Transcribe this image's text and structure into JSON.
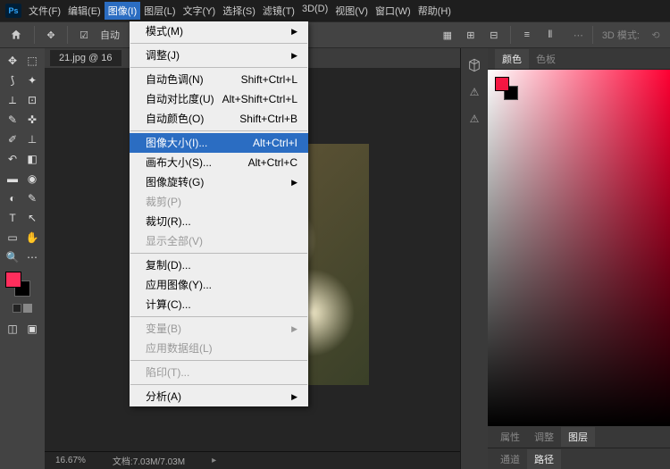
{
  "menubar": {
    "items": [
      "文件(F)",
      "编辑(E)",
      "图像(I)",
      "图层(L)",
      "文字(Y)",
      "选择(S)",
      "滤镜(T)",
      "3D(D)",
      "视图(V)",
      "窗口(W)",
      "帮助(H)"
    ],
    "active_index": 2
  },
  "toolbar": {
    "auto_label": "自动",
    "mode_label": "3D 模式:"
  },
  "document": {
    "tab": "21.jpg @ 16",
    "zoom": "16.67%",
    "docinfo": "文档:7.03M/7.03M"
  },
  "dropdown": {
    "groups": [
      [
        {
          "label": "模式(M)",
          "arrow": true
        }
      ],
      [
        {
          "label": "调整(J)",
          "arrow": true
        }
      ],
      [
        {
          "label": "自动色调(N)",
          "shortcut": "Shift+Ctrl+L"
        },
        {
          "label": "自动对比度(U)",
          "shortcut": "Alt+Shift+Ctrl+L"
        },
        {
          "label": "自动颜色(O)",
          "shortcut": "Shift+Ctrl+B"
        }
      ],
      [
        {
          "label": "图像大小(I)...",
          "shortcut": "Alt+Ctrl+I",
          "hover": true
        },
        {
          "label": "画布大小(S)...",
          "shortcut": "Alt+Ctrl+C"
        },
        {
          "label": "图像旋转(G)",
          "arrow": true
        },
        {
          "label": "裁剪(P)",
          "disabled": true
        },
        {
          "label": "裁切(R)..."
        },
        {
          "label": "显示全部(V)",
          "disabled": true
        }
      ],
      [
        {
          "label": "复制(D)..."
        },
        {
          "label": "应用图像(Y)..."
        },
        {
          "label": "计算(C)..."
        }
      ],
      [
        {
          "label": "变量(B)",
          "arrow": true,
          "disabled": true
        },
        {
          "label": "应用数据组(L)",
          "disabled": true
        }
      ],
      [
        {
          "label": "陷印(T)...",
          "disabled": true
        }
      ],
      [
        {
          "label": "分析(A)",
          "arrow": true
        }
      ]
    ]
  },
  "panels": {
    "color_tab": "颜色",
    "swatches_tab": "色板",
    "props": "属性",
    "adjust": "调整",
    "layers": "图层",
    "channels": "通道",
    "paths": "路径"
  },
  "colors": {
    "foreground": "#ff2e5c",
    "background": "#000000"
  }
}
